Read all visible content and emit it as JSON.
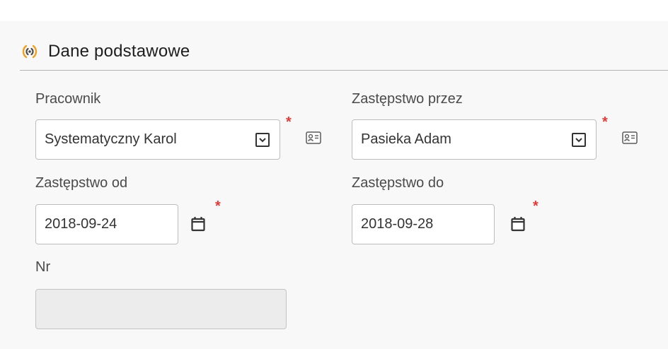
{
  "section": {
    "title": "Dane podstawowe",
    "icon": "signal-icon"
  },
  "fields": {
    "employee": {
      "label": "Pracownik",
      "value": "Systematyczny Karol",
      "required_mark": "*"
    },
    "substitute": {
      "label": "Zastępstwo przez",
      "value": "Pasieka Adam",
      "required_mark": "*"
    },
    "date_from": {
      "label": "Zastępstwo od",
      "value": "2018-09-24",
      "required_mark": "*"
    },
    "date_to": {
      "label": "Zastępstwo do",
      "value": "2018-09-28",
      "required_mark": "*"
    },
    "number": {
      "label": "Nr",
      "value": ""
    }
  },
  "colors": {
    "accent": "#f0a020",
    "required": "#e33a3a",
    "border": "#bdbdbd"
  }
}
